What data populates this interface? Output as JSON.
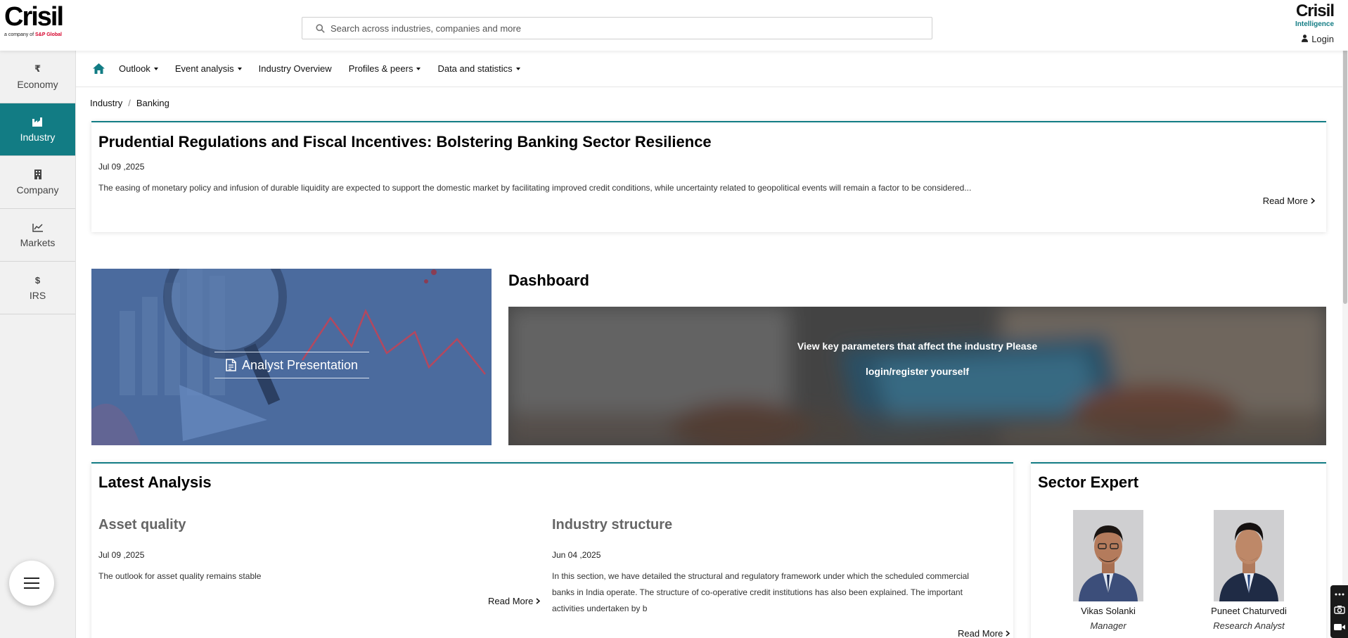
{
  "header": {
    "logo_text": "Crisil",
    "logo_tagline_prefix": "a company of",
    "logo_tagline_brand": "S&P Global",
    "search_placeholder": "Search across industries, companies and more",
    "brand_right_title": "Crisil",
    "brand_right_subtitle": "Intelligence",
    "login_label": "Login"
  },
  "sidebar": {
    "items": [
      {
        "label": "Economy",
        "icon": "rupee-icon",
        "glyph": "₹",
        "active": false
      },
      {
        "label": "Industry",
        "icon": "factory-icon",
        "glyph": "",
        "active": true
      },
      {
        "label": "Company",
        "icon": "building-icon",
        "glyph": "",
        "active": false
      },
      {
        "label": "Markets",
        "icon": "line-chart-icon",
        "glyph": "",
        "active": false
      },
      {
        "label": "IRS",
        "icon": "dollar-icon",
        "glyph": "$",
        "active": false
      }
    ]
  },
  "nav": {
    "items": [
      {
        "label": "Outlook",
        "dropdown": true
      },
      {
        "label": "Event analysis",
        "dropdown": true
      },
      {
        "label": "Industry Overview",
        "dropdown": false
      },
      {
        "label": "Profiles & peers",
        "dropdown": true
      },
      {
        "label": "Data and statistics",
        "dropdown": true
      }
    ]
  },
  "breadcrumb": {
    "items": [
      "Industry",
      "Banking"
    ],
    "separator": "/"
  },
  "featured": {
    "title": "Prudential Regulations and Fiscal Incentives: Bolstering Banking Sector Resilience",
    "date": "Jul 09 ,2025",
    "summary": "The easing of monetary policy and infusion of durable liquidity are expected to support the domestic market by facilitating improved credit conditions, while uncertainty related to geopolitical events will remain a factor to be considered...",
    "read_more": "Read More"
  },
  "analyst": {
    "button_label": "Analyst Presentation"
  },
  "dashboard": {
    "title": "Dashboard",
    "line1": "View key parameters that affect the industry Please",
    "line2": "login/register yourself"
  },
  "latest": {
    "title": "Latest Analysis",
    "articles": [
      {
        "title": "Asset quality",
        "date": "Jul 09 ,2025",
        "summary": "The outlook for asset quality remains stable",
        "read_more": "Read More"
      },
      {
        "title": "Industry structure",
        "date": "Jun 04 ,2025",
        "summary": "In this section, we have detailed the structural and regulatory framework under which the scheduled commercial banks in India operate. The structure of co-operative credit institutions has also been explained. The important activities undertaken by b",
        "read_more": "Read More"
      }
    ]
  },
  "expert": {
    "title": "Sector Expert",
    "people": [
      {
        "name": "Vikas Solanki",
        "role": "Manager"
      },
      {
        "name": "Puneet Chaturvedi",
        "role": "Research Analyst"
      }
    ]
  },
  "colors": {
    "accent": "#127c84",
    "sidebar_bg": "#f1f1f1",
    "analyst_overlay": "#4a6a9c"
  }
}
